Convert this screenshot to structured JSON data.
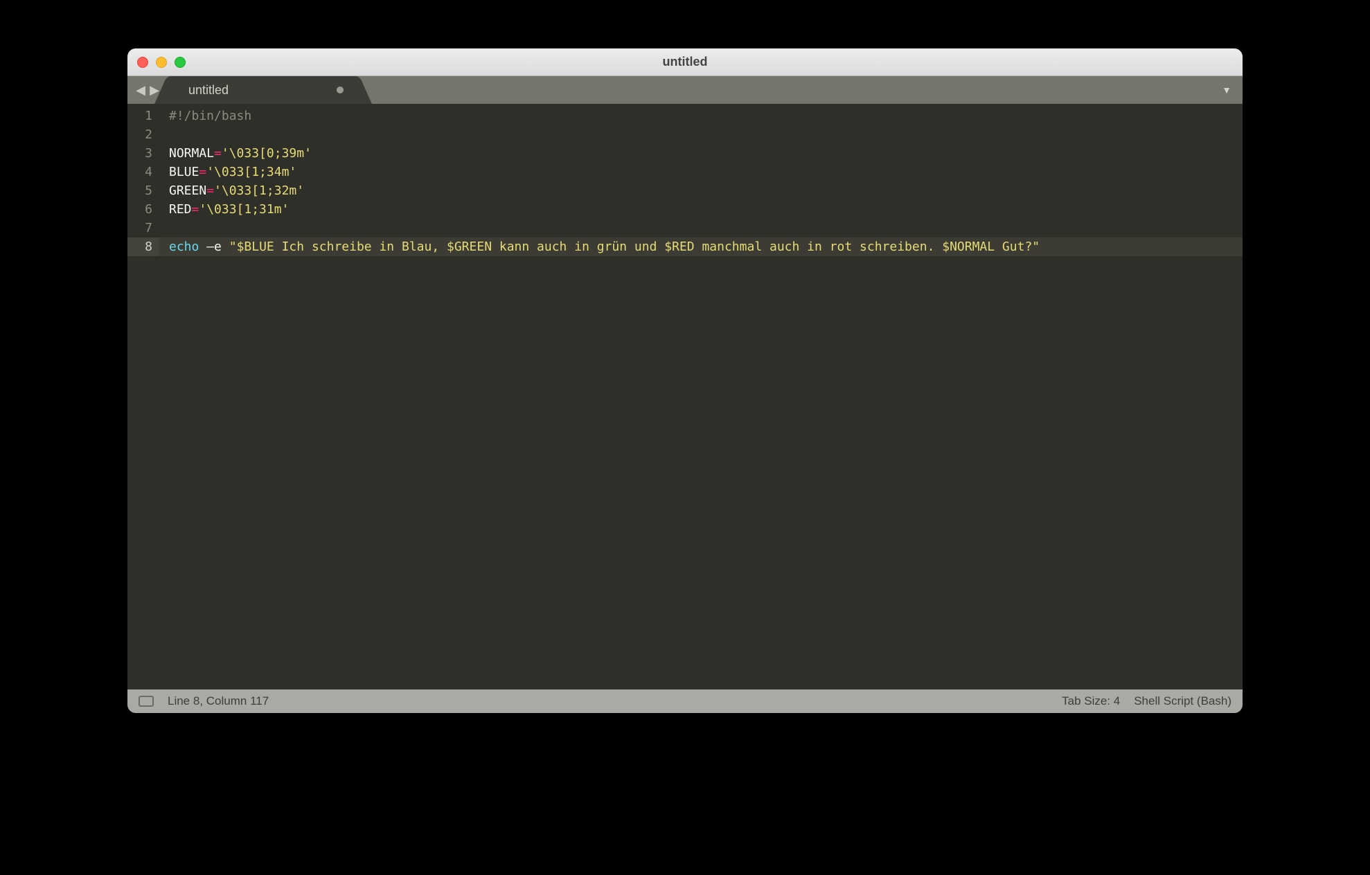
{
  "window": {
    "title": "untitled"
  },
  "tabbar": {
    "active_tab_label": "untitled"
  },
  "code": {
    "lines": [
      {
        "n": "1",
        "tokens": [
          {
            "t": "#!/bin/bash",
            "c": "c-comment"
          }
        ]
      },
      {
        "n": "2",
        "tokens": []
      },
      {
        "n": "3",
        "tokens": [
          {
            "t": "NORMAL",
            "c": "c-var"
          },
          {
            "t": "=",
            "c": "c-op"
          },
          {
            "t": "'\\033[0;39m'",
            "c": "c-str"
          }
        ]
      },
      {
        "n": "4",
        "tokens": [
          {
            "t": "BLUE",
            "c": "c-var"
          },
          {
            "t": "=",
            "c": "c-op"
          },
          {
            "t": "'\\033[1;34m'",
            "c": "c-str"
          }
        ]
      },
      {
        "n": "5",
        "tokens": [
          {
            "t": "GREEN",
            "c": "c-var"
          },
          {
            "t": "=",
            "c": "c-op"
          },
          {
            "t": "'\\033[1;32m'",
            "c": "c-str"
          }
        ]
      },
      {
        "n": "6",
        "tokens": [
          {
            "t": "RED",
            "c": "c-var"
          },
          {
            "t": "=",
            "c": "c-op"
          },
          {
            "t": "'\\033[1;31m'",
            "c": "c-str"
          }
        ]
      },
      {
        "n": "7",
        "tokens": []
      },
      {
        "n": "8",
        "hl": true,
        "tokens": [
          {
            "t": "echo",
            "c": "c-cmd"
          },
          {
            "t": " ",
            "c": ""
          },
          {
            "t": "–e",
            "c": "c-flag"
          },
          {
            "t": " ",
            "c": ""
          },
          {
            "t": "\"$BLUE Ich schreibe in Blau, $GREEN kann auch in grün und $RED manchmal auch in rot schreiben. $NORMAL Gut?\"",
            "c": "c-str"
          }
        ]
      }
    ]
  },
  "statusbar": {
    "position": "Line 8, Column 117",
    "tabsize": "Tab Size: 4",
    "syntax": "Shell Script (Bash)"
  }
}
